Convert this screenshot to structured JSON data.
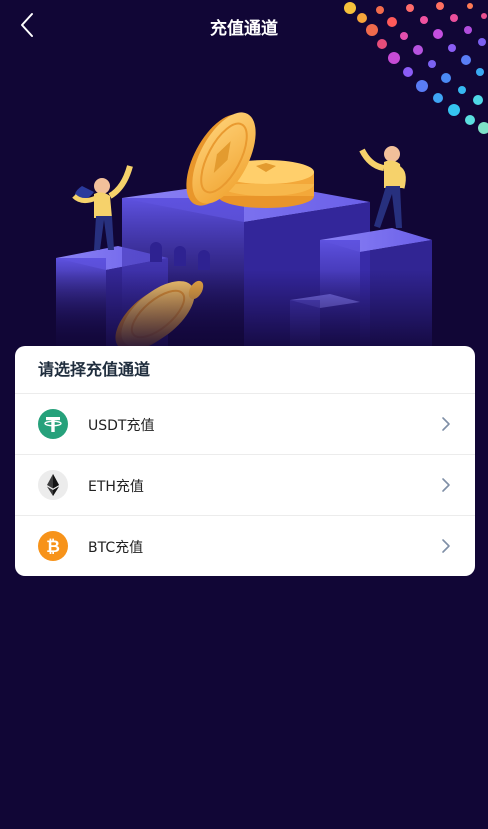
{
  "header": {
    "title": "充值通道",
    "back_icon": "chevron-left-icon"
  },
  "hero": {
    "illustration": "coin-platform-illustration",
    "decoration": "colorful-dot-swirl"
  },
  "card": {
    "title": "请选择充值通道",
    "items": [
      {
        "label": "USDT充值",
        "icon": "usdt-icon",
        "icon_color": "#26a17b"
      },
      {
        "label": "ETH充值",
        "icon": "eth-icon",
        "icon_color": "#3c3c3d"
      },
      {
        "label": "BTC充值",
        "icon": "btc-icon",
        "icon_color": "#f7931a"
      }
    ]
  },
  "colors": {
    "background": "#110636",
    "card": "#ffffff",
    "accent_gold": "#f5b041",
    "platform_purple": "#5b4fd6"
  }
}
